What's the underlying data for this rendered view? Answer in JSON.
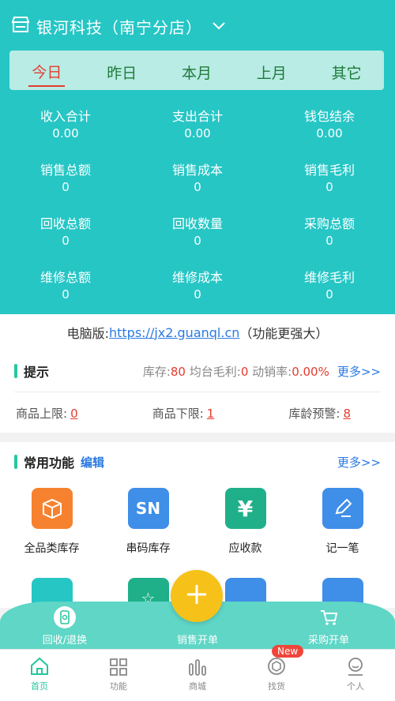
{
  "header": {
    "store_name": "银河科技（南宁分店）"
  },
  "tabs": [
    {
      "label": "今日",
      "active": true
    },
    {
      "label": "昨日",
      "active": false
    },
    {
      "label": "本月",
      "active": false
    },
    {
      "label": "上月",
      "active": false
    },
    {
      "label": "其它",
      "active": false
    }
  ],
  "stats": [
    {
      "label": "收入合计",
      "value": "0.00"
    },
    {
      "label": "支出合计",
      "value": "0.00"
    },
    {
      "label": "钱包结余",
      "value": "0.00"
    },
    {
      "label": "销售总额",
      "value": "0"
    },
    {
      "label": "销售成本",
      "value": "0"
    },
    {
      "label": "销售毛利",
      "value": "0"
    },
    {
      "label": "回收总额",
      "value": "0"
    },
    {
      "label": "回收数量",
      "value": "0"
    },
    {
      "label": "采购总额",
      "value": "0"
    },
    {
      "label": "维修总额",
      "value": "0"
    },
    {
      "label": "维修成本",
      "value": "0"
    },
    {
      "label": "维修毛利",
      "value": "0"
    }
  ],
  "pc": {
    "prefix": "电脑版:",
    "url": "https://jx2.guanql.cn",
    "suffix": "（功能更强大）"
  },
  "tips": {
    "title": "提示",
    "stock_label": "库存:",
    "stock_value": "80",
    "avg_label": "均台毛利:",
    "avg_value": "0",
    "rate_label": "动销率:",
    "rate_value": "0.00%",
    "more": "更多>>",
    "upper_label": "商品上限:",
    "upper_value": "0",
    "lower_label": "商品下限:",
    "lower_value": "1",
    "age_label": "库龄预警:",
    "age_value": "8"
  },
  "functions": {
    "title": "常用功能",
    "edit": "编辑",
    "more": "更多>>",
    "items": [
      {
        "label": "全品类库存",
        "icon": "box-icon",
        "color": "#f6822f"
      },
      {
        "label": "串码库存",
        "icon": "sn-icon",
        "text": "SN",
        "color": "#3f8ee8"
      },
      {
        "label": "应收款",
        "icon": "yen-icon",
        "text": "¥",
        "color": "#1fb08a"
      },
      {
        "label": "记一笔",
        "icon": "edit-icon",
        "color": "#3f8ee8"
      }
    ]
  },
  "ops": [
    {
      "label": "回收/退换",
      "icon": "phone-recycle-icon"
    },
    {
      "label": "销售开单",
      "icon": "plus-icon"
    },
    {
      "label": "采购开单",
      "icon": "cart-icon"
    }
  ],
  "tabbar": [
    {
      "label": "首页",
      "icon": "home-icon",
      "active": true
    },
    {
      "label": "功能",
      "icon": "grid-icon",
      "active": false
    },
    {
      "label": "商城",
      "icon": "chart-icon",
      "active": false
    },
    {
      "label": "找货",
      "icon": "package-icon",
      "active": false,
      "badge": "New"
    },
    {
      "label": "个人",
      "icon": "user-icon",
      "active": false
    }
  ]
}
